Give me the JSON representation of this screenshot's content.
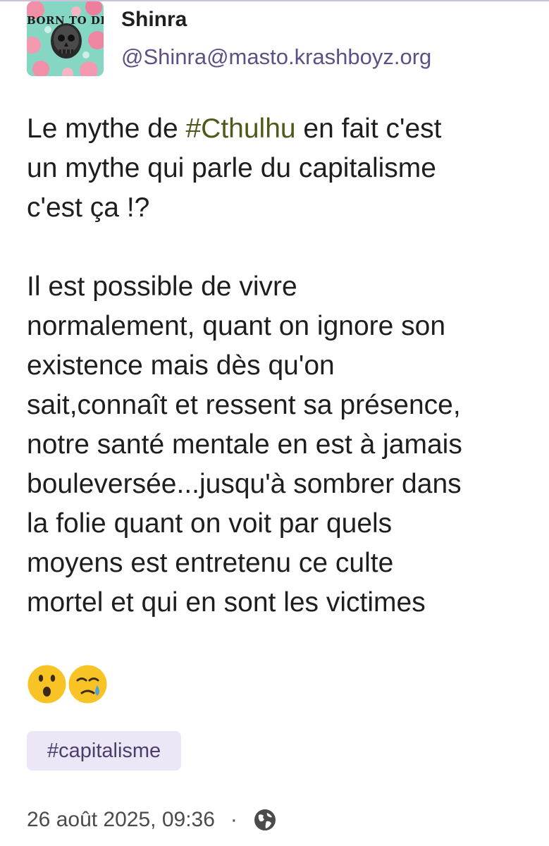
{
  "post": {
    "author": {
      "display_name": "Shinra",
      "handle": "@Shinra@masto.krashboyz.org",
      "avatar_text": "BORN TO DIE"
    },
    "content": {
      "line1_before": "Le mythe de ",
      "hashtag": "#Cthulhu",
      "line1_after": " en fait c'est",
      "line2": "un mythe qui parle du capitalisme",
      "line3": "c'est ça !?",
      "paragraph2": [
        "Il est possible de vivre",
        "normalement, quant on ignore son",
        "existence mais dès qu'on",
        "sait,connaît et ressent sa présence,",
        "notre santé mentale en est à jamais",
        "bouleversée...jusqu'à sombrer dans",
        "la folie quant on voit par quels",
        "moyens est entretenu ce culte",
        "mortel et qui en sont les victimes"
      ],
      "emojis": [
        "surprised-face-icon",
        "crying-face-icon"
      ]
    },
    "tag": "#capitalisme",
    "timestamp": "26 août 2025, 09:36",
    "separator": "·",
    "visibility_icon": "globe-icon"
  },
  "colors": {
    "handle": "#5f4f86",
    "hashtag_inline": "#4e5a1a",
    "tag_chip_bg": "#ece6f7"
  }
}
